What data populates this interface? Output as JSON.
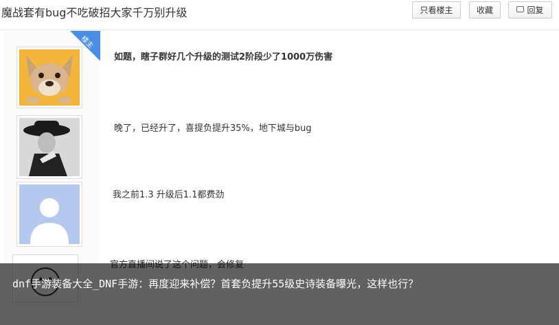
{
  "header": {
    "thread_title": "魔战套有bug不吃破招大家千万别升级",
    "buttons": {
      "only_op": "只看楼主",
      "collect": "收藏",
      "reply": "回复",
      "reply_icon": "comment-icon"
    }
  },
  "badge": {
    "label": "楼主",
    "color": "#4a8ee6"
  },
  "posts": [
    {
      "text": "如题，瞎子群好几个升级的测试2阶段少了1000万伤害",
      "avatar": "dog-avatar"
    },
    {
      "text": "晚了，已经升了，喜提负提升35%，地下城与bug",
      "avatar": "hat-person-avatar"
    },
    {
      "text": "我之前1.3 升级后1.1都费劲",
      "avatar": "default-avatar"
    },
    {
      "text": "官方直播间说了这个问题，会修复",
      "avatar": "meme-avatar"
    }
  ],
  "caption": {
    "text": "dnf手游装备大全_DNF手游：再度迎来补偿？首套负提升55级史诗装备曝光，这样也行？"
  }
}
